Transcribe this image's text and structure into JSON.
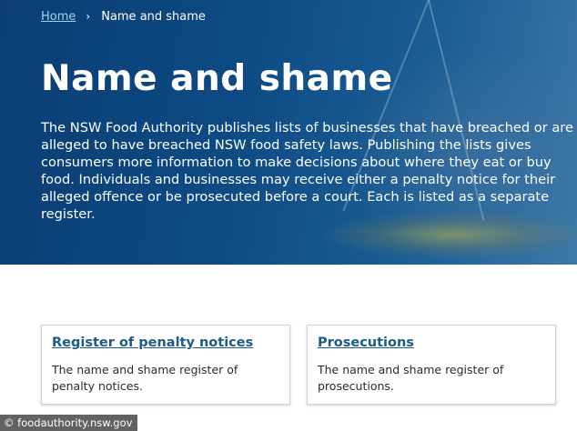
{
  "breadcrumb": {
    "home": "Home",
    "separator": "›",
    "current": "Name and shame"
  },
  "hero": {
    "title": "Name and shame",
    "intro": "The NSW Food Authority publishes lists of businesses that have breached or are alleged to have breached NSW food safety laws. Publishing the lists gives consumers more information to make decisions about where they eat or buy food. Individuals and businesses may receive either a penalty notice for their alleged offence or be prosecuted before a court. Each is listed as a separate register."
  },
  "cards": [
    {
      "title": "Register of penalty notices",
      "description": "The name and shame register of penalty notices."
    },
    {
      "title": "Prosecutions",
      "description": "The name and shame register of prosecutions."
    }
  ],
  "credit": "© foodauthority.nsw.gov",
  "colors": {
    "hero_blue": "#0d4a84",
    "link_blue": "#1b5b87",
    "breadcrumb_link": "#9fd2f5"
  }
}
